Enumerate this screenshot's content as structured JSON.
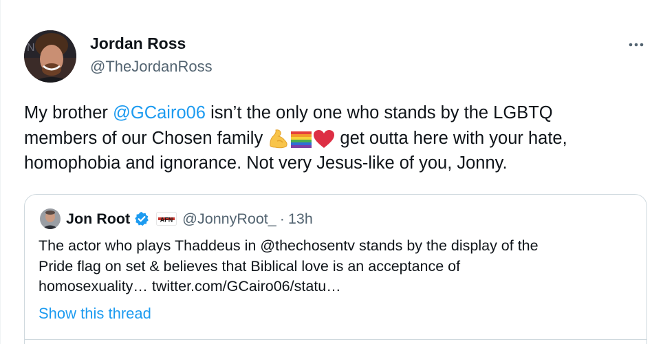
{
  "tweet": {
    "author_name": "Jordan Ross",
    "author_handle": "@TheJordanRoss",
    "more_label": "···",
    "text": {
      "line1_before": "My brother ",
      "mention": "@GCairo06",
      "line1_after": " isn’t the only one who stands by the LGBTQ",
      "line2_before": "members of our Chosen family ",
      "line2_after": " get outta here with your hate,",
      "line3": "homophobia and ignorance. Not very Jesus-like of you, Jonny."
    },
    "emojis": [
      "flexed-biceps",
      "rainbow-flag",
      "red-heart"
    ]
  },
  "quoted_tweet": {
    "author_name": "Jon Root",
    "affiliate_badge": "AFN",
    "author_handle": "@JonnyRoot_",
    "separator": "·",
    "time": "13h",
    "text": {
      "line1": "The actor who plays Thaddeus in @thechosentv stands by the display of the",
      "line2": "Pride flag on set & believes that Biblical love is an acceptance of",
      "line3_before": "homosexuality… ",
      "link": "twitter.com/GCairo06/statu…"
    },
    "show_thread": "Show this thread"
  },
  "colors": {
    "link": "#1d9bf0",
    "text": "#0f1419",
    "secondary": "#536471",
    "border": "#cfd9de",
    "verified": "#1d9bf0"
  }
}
